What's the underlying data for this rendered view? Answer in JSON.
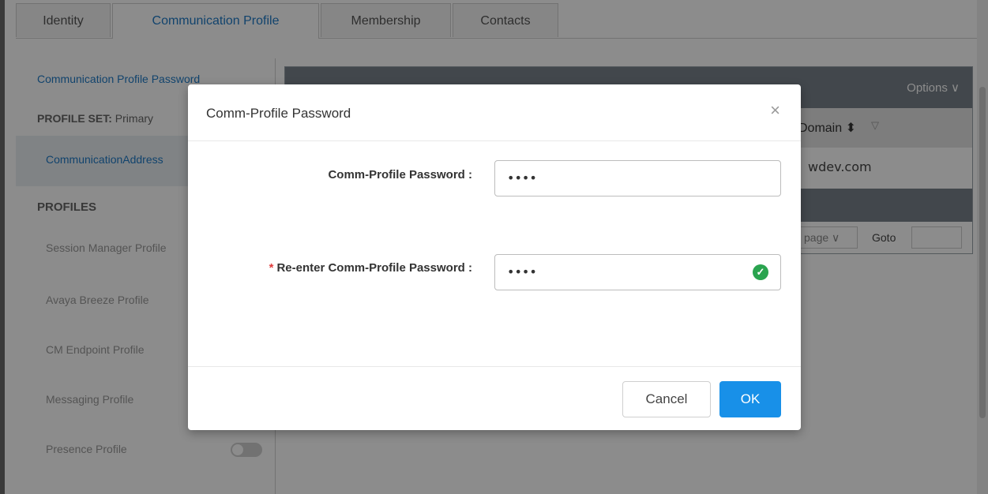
{
  "tabs": [
    "Identity",
    "Communication Profile",
    "Membership",
    "Contacts"
  ],
  "left_panel": {
    "link": "Communication Profile Password",
    "profile_set_label": "PROFILE SET:",
    "profile_set_value": "Primary",
    "selected_item": "CommunicationAddress",
    "profiles_heading": "PROFILES",
    "items": [
      "Session Manager Profile",
      "Avaya Breeze Profile",
      "CM Endpoint Profile",
      "Messaging Profile",
      "Presence Profile"
    ]
  },
  "grid": {
    "options": "Options ∨",
    "column": "Domain",
    "cell": "wdev.com",
    "pager_select": "page ∨",
    "goto_label": "Goto"
  },
  "modal": {
    "title": "Comm-Profile Password",
    "close": "×",
    "password_label": "Comm-Profile Password :",
    "password_value": "••••",
    "reenter_required": "*",
    "reenter_label": "Re-enter Comm-Profile Password :",
    "reenter_value": "••••",
    "cancel": "Cancel",
    "ok": "OK"
  },
  "colors": {
    "accent": "#1890e8",
    "link": "#1f7bc6",
    "success": "#2aa44f",
    "required": "#e03b3b"
  },
  "icons": [
    "close-icon",
    "check-circle-icon",
    "sort-icon",
    "filter-icon",
    "toggle-switch"
  ]
}
